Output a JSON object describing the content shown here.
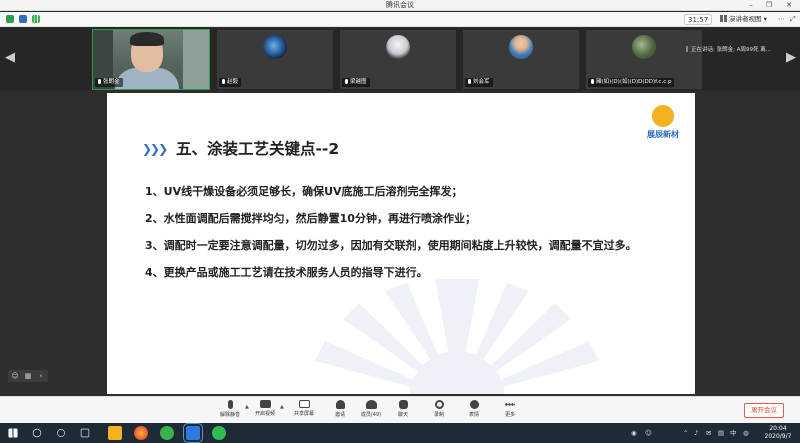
{
  "window": {
    "title": "腾讯会议",
    "min": "–",
    "max": "❐",
    "close": "✕"
  },
  "status": {
    "timer": "31:57",
    "view_mode": "演讲者视图",
    "view_caret": "▾",
    "more": "⋯",
    "fullscreen": "⤢"
  },
  "participants": [
    {
      "name": "张朗金",
      "kind": "video"
    },
    {
      "name": "赵毅",
      "kind": "avatar",
      "color": "#1b3b66"
    },
    {
      "name": "梁越图",
      "kind": "avatar",
      "color": "#dfe3ea"
    },
    {
      "name": "刘会军",
      "kind": "avatar",
      "color": "#4a7fb8"
    },
    {
      "name": "厢(如)(D)(如)(D)D(DD)f.c.c.p",
      "kind": "avatar",
      "color": "#56684b"
    }
  ],
  "speaking": {
    "text": "正在讲话: 张朗金; A周99死 离..."
  },
  "slide": {
    "heading": "五、涂装工艺关键点--2",
    "chevrons": "❯❯❯",
    "logo_text": "展辰新材",
    "points": [
      "1、UV线干燥设备必须足够长，确保UV底施工后溶剂完全挥发；",
      "2、水性面调配后需搅拌均匀，然后静置10分钟，再进行喷涂作业；",
      "3、调配时一定要注意调配量，切勿过多，因加有交联剂，使用期间粘度上升较快，调配量不宜过多。",
      "4、更换产品或施工工艺请在技术服务人员的指导下进行。"
    ]
  },
  "toolbar": {
    "buttons": [
      {
        "label": "解除静音",
        "icon": "mic-muted-icon"
      },
      {
        "label": "开启视频",
        "icon": "video-off-icon"
      },
      {
        "label": "共享屏幕",
        "icon": "share-screen-icon"
      },
      {
        "label": "邀请",
        "icon": "invite-icon"
      },
      {
        "label": "成员(49)",
        "icon": "members-icon"
      },
      {
        "label": "聊天",
        "icon": "chat-icon"
      },
      {
        "label": "录制",
        "icon": "record-icon"
      },
      {
        "label": "表情",
        "icon": "emoji-icon"
      },
      {
        "label": "更多",
        "icon": "more-icon"
      }
    ],
    "leave_label": "离开会议"
  },
  "taskbar": {
    "time": "20:04",
    "date": "2020/9/7",
    "ime": "中",
    "apps": [
      "start",
      "search",
      "task-view",
      "file-explorer",
      "firefox",
      "360-browser",
      "tencent-meeting",
      "wechat"
    ]
  },
  "colors": {
    "accent_blue": "#2d6bc7",
    "logo_yellow": "#f2b21f",
    "leave_red": "#e0483a",
    "active_green": "#2f9a54"
  }
}
